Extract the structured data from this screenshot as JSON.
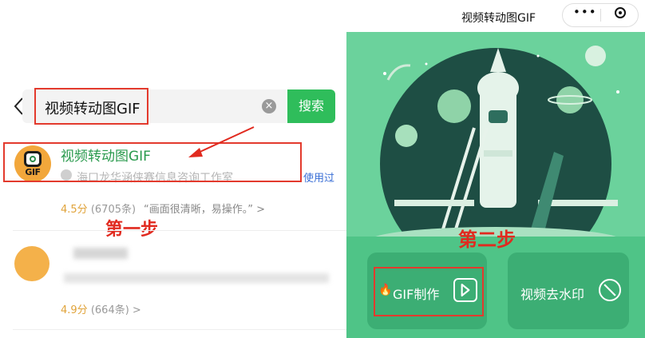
{
  "search": {
    "query": "视频转动图GIF",
    "button_label": "搜索"
  },
  "results": [
    {
      "name": "视频转动图GIF",
      "icon_text": "GIF",
      "company": "海口龙华涵侠赛信息咨询工作室",
      "used_label": "使用过",
      "rating": "4.5分",
      "count": "(6705条)",
      "review": "“画面很清晰，易操作。” >"
    },
    {
      "rating": "4.9分",
      "count": "(664条) >"
    }
  ],
  "annotations": {
    "step1": "第一步",
    "step2": "第二步"
  },
  "miniapp": {
    "title": "视频转动图GIF",
    "capsule_more": "•••",
    "gif_make_label": "GIF制作",
    "watermark_label": "视频去水印"
  },
  "colors": {
    "accent_green": "#2fbd5b",
    "annotation_red": "#e12a1f",
    "panel_green": "#6bd29c"
  }
}
